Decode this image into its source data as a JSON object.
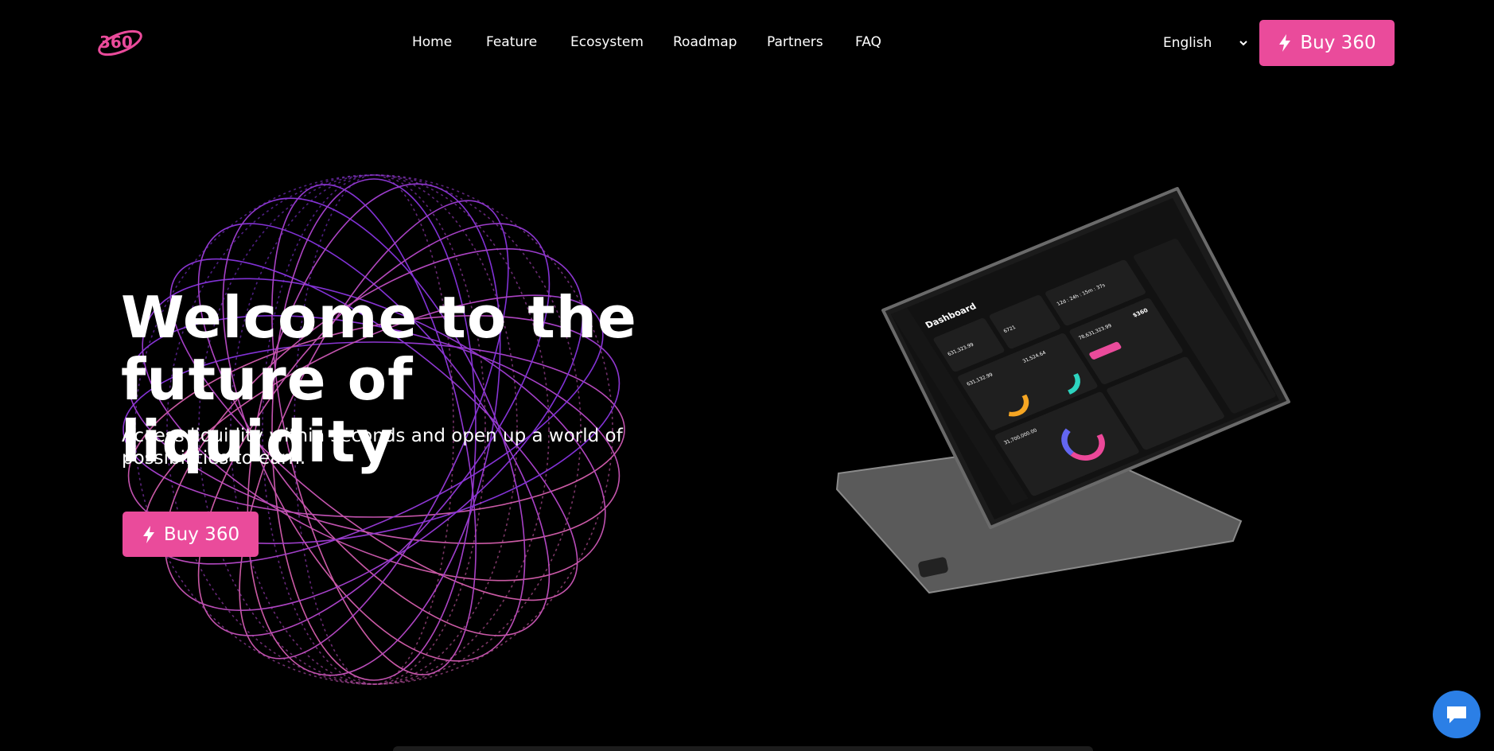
{
  "brand": {
    "logo_text": "360",
    "accent": "#ea4b9b"
  },
  "nav": {
    "items": [
      {
        "label": "Home"
      },
      {
        "label": "Feature"
      },
      {
        "label": "Ecosystem"
      },
      {
        "label": "Roadmap"
      },
      {
        "label": "Partners"
      },
      {
        "label": "FAQ"
      }
    ]
  },
  "language": {
    "selected": "English",
    "icon": "chevron-down-icon"
  },
  "header": {
    "buy_label": "Buy 360",
    "buy_icon": "bolt-icon"
  },
  "hero": {
    "headline_line1": "Welcome to the",
    "headline_line2": "future of liquidity",
    "subtitle": "Access liquidity within seconds and open up a world of possibilities to earn.",
    "buy_label": "Buy 360"
  },
  "tablet": {
    "dashboard_title": "Dashboard",
    "values": [
      "631,323.99",
      "6721",
      "631,132.99",
      "31,524.64",
      "78,631,323.99",
      "$360",
      "31,700,000.00",
      "12d : 24h : 15m : 37s"
    ]
  },
  "chat": {
    "icon": "chat-bubble-icon"
  }
}
